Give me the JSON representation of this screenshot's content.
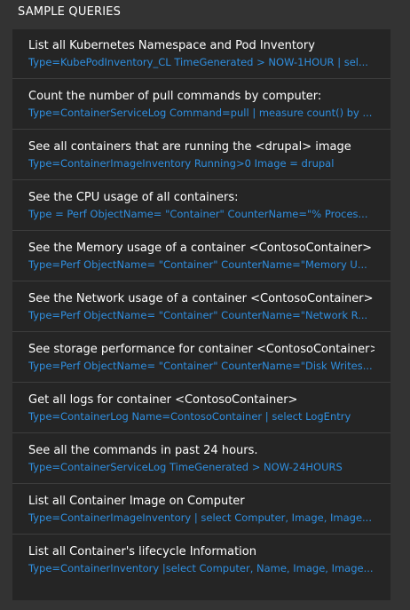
{
  "header": {
    "title": "SAMPLE QUERIES"
  },
  "queries": [
    {
      "title": "List all Kubernetes Namespace and Pod Inventory",
      "query": "Type=KubePodInventory_CL TimeGenerated > NOW-1HOUR | sel..."
    },
    {
      "title": "Count the number of pull commands by computer:",
      "query": "Type=ContainerServiceLog Command=pull | measure count() by ..."
    },
    {
      "title": "See all containers that are running the <drupal> image",
      "query": "Type=ContainerImageInventory Running>0 Image = drupal"
    },
    {
      "title": "See the CPU usage of all containers:",
      "query": "Type = Perf ObjectName= \"Container\" CounterName=\"% Proces..."
    },
    {
      "title": "See the Memory usage of a container <ContosoContainer>",
      "query": "Type=Perf ObjectName= \"Container\" CounterName=\"Memory U..."
    },
    {
      "title": "See the Network usage of a container <ContosoContainer>",
      "query": "Type=Perf ObjectName= \"Container\" CounterName=\"Network R..."
    },
    {
      "title": "See storage performance for container <ContosoContainer>",
      "query": "Type=Perf ObjectName= \"Container\" CounterName=\"Disk Writes..."
    },
    {
      "title": "Get all logs for container <ContosoContainer>",
      "query": "Type=ContainerLog Name=ContosoContainer | select LogEntry"
    },
    {
      "title": "See all the commands in past 24 hours.",
      "query": "Type=ContainerServiceLog TimeGenerated > NOW-24HOURS"
    },
    {
      "title": "List all Container Image on Computer",
      "query": "Type=ContainerImageInventory | select Computer, Image, Image..."
    },
    {
      "title": "List all Container's lifecycle Information",
      "query": "Type=ContainerInventory |select Computer, Name, Image, Image..."
    }
  ]
}
